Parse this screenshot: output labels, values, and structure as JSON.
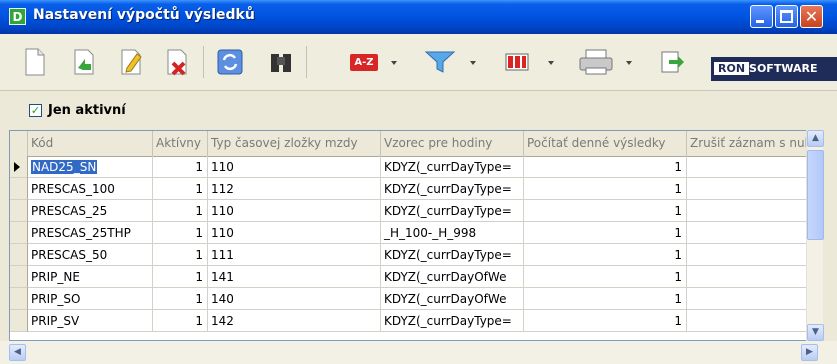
{
  "window": {
    "title": "Nastavení výpočtů výsledků",
    "app_icon_letter": "D"
  },
  "toolbar": {
    "logo_left": "RON",
    "logo_right": "SOFTWARE",
    "sort_label": "A-Z"
  },
  "filter": {
    "active_only_label": "Jen aktivní",
    "checked": true
  },
  "grid": {
    "columns": [
      "Kód",
      "Aktívny",
      "Typ časovej zložky mzdy",
      "Vzorec pre hodiny",
      "Počítať denné výsledky",
      "Zrušiť záznam s nul"
    ],
    "rows": [
      {
        "kod": "NAD25_SN",
        "aktivny": "1",
        "typ": "110",
        "vzorec": "KDYZ(_currDayType=",
        "pocitat": "1"
      },
      {
        "kod": "PRESCAS_100",
        "aktivny": "1",
        "typ": "112",
        "vzorec": "KDYZ(_currDayType=",
        "pocitat": "1"
      },
      {
        "kod": "PRESCAS_25",
        "aktivny": "1",
        "typ": "110",
        "vzorec": "KDYZ(_currDayType=",
        "pocitat": "1"
      },
      {
        "kod": "PRESCAS_25THP",
        "aktivny": "1",
        "typ": "110",
        "vzorec": "_H_100-_H_998",
        "pocitat": "1"
      },
      {
        "kod": "PRESCAS_50",
        "aktivny": "1",
        "typ": "111",
        "vzorec": "KDYZ(_currDayType=",
        "pocitat": "1"
      },
      {
        "kod": "PRIP_NE",
        "aktivny": "1",
        "typ": "141",
        "vzorec": "KDYZ(_currDayOfWe",
        "pocitat": "1"
      },
      {
        "kod": "PRIP_SO",
        "aktivny": "1",
        "typ": "140",
        "vzorec": "KDYZ(_currDayOfWe",
        "pocitat": "1"
      },
      {
        "kod": "PRIP_SV",
        "aktivny": "1",
        "typ": "142",
        "vzorec": "KDYZ(_currDayType=",
        "pocitat": "1"
      }
    ]
  }
}
